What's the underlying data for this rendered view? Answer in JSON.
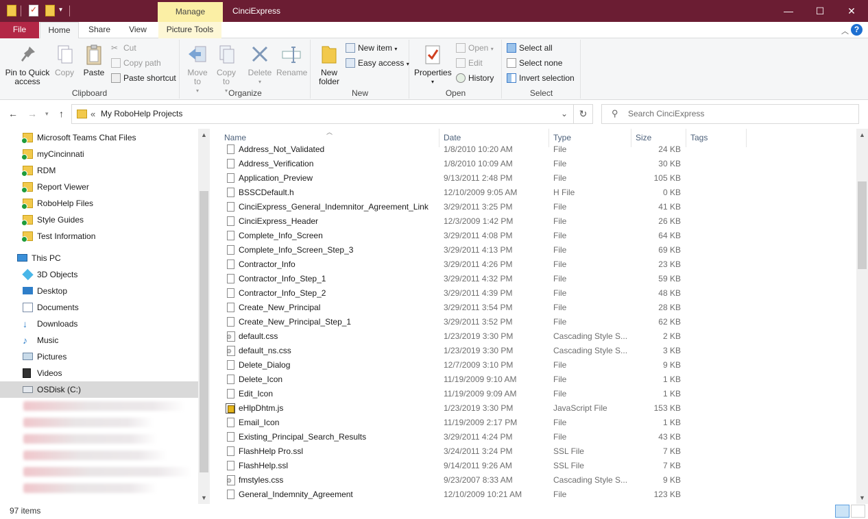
{
  "window": {
    "title": "CinciExpress",
    "context_tab": "Manage",
    "controls": {
      "minimize": "—",
      "maximize": "☐",
      "close": "✕"
    }
  },
  "ribbon_tabs": [
    "File",
    "Home",
    "Share",
    "View",
    "Picture Tools"
  ],
  "ribbon": {
    "clipboard": {
      "label": "Clipboard",
      "pin": "Pin to Quick access",
      "copy": "Copy",
      "paste": "Paste",
      "cut": "Cut",
      "copy_path": "Copy path",
      "paste_shortcut": "Paste shortcut"
    },
    "organize": {
      "label": "Organize",
      "move_to": "Move to",
      "copy_to": "Copy to",
      "delete": "Delete",
      "rename": "Rename"
    },
    "new": {
      "label": "New",
      "new_folder": "New folder",
      "new_item": "New item",
      "easy_access": "Easy access"
    },
    "open": {
      "label": "Open",
      "properties": "Properties",
      "open": "Open",
      "edit": "Edit",
      "history": "History"
    },
    "select": {
      "label": "Select",
      "select_all": "Select all",
      "select_none": "Select none",
      "invert_selection": "Invert selection"
    }
  },
  "address": {
    "path": "My RoboHelp Projects",
    "search_placeholder": "Search CinciExpress"
  },
  "nav_pane": {
    "quick_access": [
      "Microsoft Teams Chat Files",
      "myCincinnati",
      "RDM",
      "Report Viewer",
      "RoboHelp Files",
      "Style Guides",
      "Test Information"
    ],
    "this_pc": "This PC",
    "pc_items": [
      {
        "label": "3D Objects",
        "icon": "3d-objects-icon"
      },
      {
        "label": "Desktop",
        "icon": "desktop-icon"
      },
      {
        "label": "Documents",
        "icon": "documents-icon"
      },
      {
        "label": "Downloads",
        "icon": "downloads-icon"
      },
      {
        "label": "Music",
        "icon": "music-icon"
      },
      {
        "label": "Pictures",
        "icon": "pictures-icon"
      },
      {
        "label": "Videos",
        "icon": "videos-icon"
      },
      {
        "label": "OSDisk (C:)",
        "icon": "drive-icon"
      }
    ]
  },
  "columns": {
    "name": "Name",
    "date": "Date",
    "type": "Type",
    "size": "Size",
    "tags": "Tags"
  },
  "files": [
    {
      "name": "Address_Not_Validated",
      "date": "1/8/2010 10:20 AM",
      "type": "File",
      "size": "24 KB",
      "icon": "file"
    },
    {
      "name": "Address_Verification",
      "date": "1/8/2010 10:09 AM",
      "type": "File",
      "size": "30 KB",
      "icon": "file"
    },
    {
      "name": "Application_Preview",
      "date": "9/13/2011 2:48 PM",
      "type": "File",
      "size": "105 KB",
      "icon": "file"
    },
    {
      "name": "BSSCDefault.h",
      "date": "12/10/2009 9:05 AM",
      "type": "H File",
      "size": "0 KB",
      "icon": "file"
    },
    {
      "name": "CinciExpress_General_Indemnitor_Agreement_Link",
      "date": "3/29/2011 3:25 PM",
      "type": "File",
      "size": "41 KB",
      "icon": "file"
    },
    {
      "name": "CinciExpress_Header",
      "date": "12/3/2009 1:42 PM",
      "type": "File",
      "size": "26 KB",
      "icon": "file"
    },
    {
      "name": "Complete_Info_Screen",
      "date": "3/29/2011 4:08 PM",
      "type": "File",
      "size": "64 KB",
      "icon": "file"
    },
    {
      "name": "Complete_Info_Screen_Step_3",
      "date": "3/29/2011 4:13 PM",
      "type": "File",
      "size": "69 KB",
      "icon": "file"
    },
    {
      "name": "Contractor_Info",
      "date": "3/29/2011 4:26 PM",
      "type": "File",
      "size": "23 KB",
      "icon": "file"
    },
    {
      "name": "Contractor_Info_Step_1",
      "date": "3/29/2011 4:32 PM",
      "type": "File",
      "size": "59 KB",
      "icon": "file"
    },
    {
      "name": "Contractor_Info_Step_2",
      "date": "3/29/2011 4:39 PM",
      "type": "File",
      "size": "48 KB",
      "icon": "file"
    },
    {
      "name": "Create_New_Principal",
      "date": "3/29/2011 3:54 PM",
      "type": "File",
      "size": "28 KB",
      "icon": "file"
    },
    {
      "name": "Create_New_Principal_Step_1",
      "date": "3/29/2011 3:52 PM",
      "type": "File",
      "size": "62 KB",
      "icon": "file"
    },
    {
      "name": "default.css",
      "date": "1/23/2019 3:30 PM",
      "type": "Cascading Style S...",
      "size": "2 KB",
      "icon": "css"
    },
    {
      "name": "default_ns.css",
      "date": "1/23/2019 3:30 PM",
      "type": "Cascading Style S...",
      "size": "3 KB",
      "icon": "css"
    },
    {
      "name": "Delete_Dialog",
      "date": "12/7/2009 3:10 PM",
      "type": "File",
      "size": "9 KB",
      "icon": "file"
    },
    {
      "name": "Delete_Icon",
      "date": "11/19/2009 9:10 AM",
      "type": "File",
      "size": "1 KB",
      "icon": "file"
    },
    {
      "name": "Edit_Icon",
      "date": "11/19/2009 9:09 AM",
      "type": "File",
      "size": "1 KB",
      "icon": "file"
    },
    {
      "name": "eHlpDhtm.js",
      "date": "1/23/2019 3:30 PM",
      "type": "JavaScript File",
      "size": "153 KB",
      "icon": "js"
    },
    {
      "name": "Email_Icon",
      "date": "11/19/2009 2:17 PM",
      "type": "File",
      "size": "1 KB",
      "icon": "file"
    },
    {
      "name": "Existing_Principal_Search_Results",
      "date": "3/29/2011 4:24 PM",
      "type": "File",
      "size": "43 KB",
      "icon": "file"
    },
    {
      "name": "FlashHelp Pro.ssl",
      "date": "3/24/2011 3:24 PM",
      "type": "SSL File",
      "size": "7 KB",
      "icon": "file"
    },
    {
      "name": "FlashHelp.ssl",
      "date": "9/14/2011 9:26 AM",
      "type": "SSL File",
      "size": "7 KB",
      "icon": "file"
    },
    {
      "name": "fmstyles.css",
      "date": "9/23/2007 8:33 AM",
      "type": "Cascading Style S...",
      "size": "9 KB",
      "icon": "css"
    },
    {
      "name": "General_Indemnity_Agreement",
      "date": "12/10/2009 10:21 AM",
      "type": "File",
      "size": "123 KB",
      "icon": "file"
    }
  ],
  "status": {
    "item_count": "97 items"
  },
  "colors": {
    "titlebar": "#6b1d33",
    "file_tab": "#b32746",
    "manage_tab": "#fbefa5",
    "sync_green": "#1e9c3b",
    "folder_yellow": "#f2c94c"
  }
}
